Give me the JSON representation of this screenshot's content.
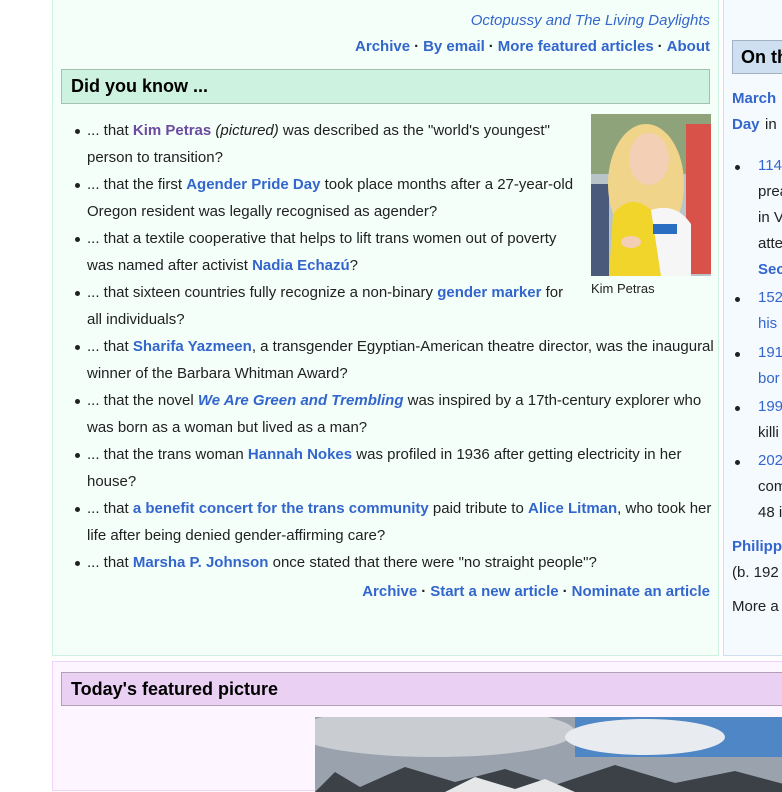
{
  "tfa": {
    "tail_text": "Octopussy and The Living Daylights",
    "footer_links": [
      "Archive",
      "By email",
      "More featured articles",
      "About"
    ]
  },
  "dyk": {
    "title": "Did you know ...",
    "image_caption": "Kim Petras",
    "items": [
      {
        "a": "... that ",
        "link": "Kim Petras",
        "b": " ",
        "it": "(pictured)",
        "c": " was described as the \"world's youngest\" person to transition?"
      },
      {
        "a": "... that the first ",
        "link": "Agender Pride Day",
        "c": " took place months after a 27-year-old Oregon resident was legally recognised as agender?"
      },
      {
        "a": "... that a textile cooperative that helps to lift trans women out of poverty was named after activist ",
        "link": "Nadia Echazú",
        "c": "?"
      },
      {
        "a": "... that sixteen countries fully recognize a non-binary ",
        "link": "gender marker",
        "c": " for all individuals?"
      },
      {
        "a": "... that ",
        "link": "Sharifa Yazmeen",
        "c": ", a transgender Egyptian-American theatre director, was the inaugural winner of the Barbara Whitman Award?"
      },
      {
        "a": "... that the novel ",
        "link": "We Are Green and Trembling",
        "c": " was inspired by a 17th-century explorer who was born as a woman but lived as a man?"
      },
      {
        "a": "... that the trans woman ",
        "link": "Hannah Nokes",
        "c": " was profiled in 1936 after getting electricity in her house?"
      },
      {
        "a": "... that ",
        "link": "a benefit concert for the trans community",
        "c": " paid tribute to ",
        "link2": "Alice Litman",
        "d": ", who took her life after being denied gender-affirming care?"
      },
      {
        "a": "... that ",
        "link": "Marsha P. Johnson",
        "c": " once stated that there were \"no straight people\"?"
      }
    ],
    "footer_links": [
      "Archive",
      "Start a new article",
      "Nominate an article"
    ]
  },
  "otd": {
    "title": "On th",
    "lines": [
      "March",
      "Day",
      "in",
      "114",
      "prea",
      "in V",
      "atte",
      "Sec",
      "152",
      "his",
      "191",
      "bor",
      "199",
      "killi",
      "202",
      "com",
      "48 i",
      "Philipp",
      "(b. 192",
      "More a"
    ]
  },
  "tfp": {
    "title": "Today's featured picture"
  },
  "colors": {
    "link": "#3366cc",
    "visited": "#6b4ba1",
    "dyk_bg": "#f5fffa",
    "dyk_header": "#cef2e0",
    "otd_header": "#cedff2",
    "tfp_header": "#ead1f4"
  }
}
